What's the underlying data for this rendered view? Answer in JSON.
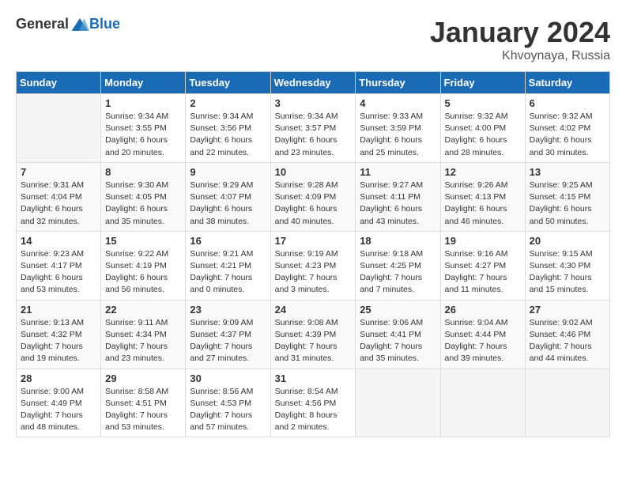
{
  "header": {
    "logo_general": "General",
    "logo_blue": "Blue",
    "month_title": "January 2024",
    "location": "Khvoynaya, Russia"
  },
  "calendar": {
    "days_of_week": [
      "Sunday",
      "Monday",
      "Tuesday",
      "Wednesday",
      "Thursday",
      "Friday",
      "Saturday"
    ],
    "weeks": [
      [
        {
          "day": "",
          "info": ""
        },
        {
          "day": "1",
          "info": "Sunrise: 9:34 AM\nSunset: 3:55 PM\nDaylight: 6 hours\nand 20 minutes."
        },
        {
          "day": "2",
          "info": "Sunrise: 9:34 AM\nSunset: 3:56 PM\nDaylight: 6 hours\nand 22 minutes."
        },
        {
          "day": "3",
          "info": "Sunrise: 9:34 AM\nSunset: 3:57 PM\nDaylight: 6 hours\nand 23 minutes."
        },
        {
          "day": "4",
          "info": "Sunrise: 9:33 AM\nSunset: 3:59 PM\nDaylight: 6 hours\nand 25 minutes."
        },
        {
          "day": "5",
          "info": "Sunrise: 9:32 AM\nSunset: 4:00 PM\nDaylight: 6 hours\nand 28 minutes."
        },
        {
          "day": "6",
          "info": "Sunrise: 9:32 AM\nSunset: 4:02 PM\nDaylight: 6 hours\nand 30 minutes."
        }
      ],
      [
        {
          "day": "7",
          "info": "Sunrise: 9:31 AM\nSunset: 4:04 PM\nDaylight: 6 hours\nand 32 minutes."
        },
        {
          "day": "8",
          "info": "Sunrise: 9:30 AM\nSunset: 4:05 PM\nDaylight: 6 hours\nand 35 minutes."
        },
        {
          "day": "9",
          "info": "Sunrise: 9:29 AM\nSunset: 4:07 PM\nDaylight: 6 hours\nand 38 minutes."
        },
        {
          "day": "10",
          "info": "Sunrise: 9:28 AM\nSunset: 4:09 PM\nDaylight: 6 hours\nand 40 minutes."
        },
        {
          "day": "11",
          "info": "Sunrise: 9:27 AM\nSunset: 4:11 PM\nDaylight: 6 hours\nand 43 minutes."
        },
        {
          "day": "12",
          "info": "Sunrise: 9:26 AM\nSunset: 4:13 PM\nDaylight: 6 hours\nand 46 minutes."
        },
        {
          "day": "13",
          "info": "Sunrise: 9:25 AM\nSunset: 4:15 PM\nDaylight: 6 hours\nand 50 minutes."
        }
      ],
      [
        {
          "day": "14",
          "info": "Sunrise: 9:23 AM\nSunset: 4:17 PM\nDaylight: 6 hours\nand 53 minutes."
        },
        {
          "day": "15",
          "info": "Sunrise: 9:22 AM\nSunset: 4:19 PM\nDaylight: 6 hours\nand 56 minutes."
        },
        {
          "day": "16",
          "info": "Sunrise: 9:21 AM\nSunset: 4:21 PM\nDaylight: 7 hours\nand 0 minutes."
        },
        {
          "day": "17",
          "info": "Sunrise: 9:19 AM\nSunset: 4:23 PM\nDaylight: 7 hours\nand 3 minutes."
        },
        {
          "day": "18",
          "info": "Sunrise: 9:18 AM\nSunset: 4:25 PM\nDaylight: 7 hours\nand 7 minutes."
        },
        {
          "day": "19",
          "info": "Sunrise: 9:16 AM\nSunset: 4:27 PM\nDaylight: 7 hours\nand 11 minutes."
        },
        {
          "day": "20",
          "info": "Sunrise: 9:15 AM\nSunset: 4:30 PM\nDaylight: 7 hours\nand 15 minutes."
        }
      ],
      [
        {
          "day": "21",
          "info": "Sunrise: 9:13 AM\nSunset: 4:32 PM\nDaylight: 7 hours\nand 19 minutes."
        },
        {
          "day": "22",
          "info": "Sunrise: 9:11 AM\nSunset: 4:34 PM\nDaylight: 7 hours\nand 23 minutes."
        },
        {
          "day": "23",
          "info": "Sunrise: 9:09 AM\nSunset: 4:37 PM\nDaylight: 7 hours\nand 27 minutes."
        },
        {
          "day": "24",
          "info": "Sunrise: 9:08 AM\nSunset: 4:39 PM\nDaylight: 7 hours\nand 31 minutes."
        },
        {
          "day": "25",
          "info": "Sunrise: 9:06 AM\nSunset: 4:41 PM\nDaylight: 7 hours\nand 35 minutes."
        },
        {
          "day": "26",
          "info": "Sunrise: 9:04 AM\nSunset: 4:44 PM\nDaylight: 7 hours\nand 39 minutes."
        },
        {
          "day": "27",
          "info": "Sunrise: 9:02 AM\nSunset: 4:46 PM\nDaylight: 7 hours\nand 44 minutes."
        }
      ],
      [
        {
          "day": "28",
          "info": "Sunrise: 9:00 AM\nSunset: 4:49 PM\nDaylight: 7 hours\nand 48 minutes."
        },
        {
          "day": "29",
          "info": "Sunrise: 8:58 AM\nSunset: 4:51 PM\nDaylight: 7 hours\nand 53 minutes."
        },
        {
          "day": "30",
          "info": "Sunrise: 8:56 AM\nSunset: 4:53 PM\nDaylight: 7 hours\nand 57 minutes."
        },
        {
          "day": "31",
          "info": "Sunrise: 8:54 AM\nSunset: 4:56 PM\nDaylight: 8 hours\nand 2 minutes."
        },
        {
          "day": "",
          "info": ""
        },
        {
          "day": "",
          "info": ""
        },
        {
          "day": "",
          "info": ""
        }
      ]
    ]
  }
}
